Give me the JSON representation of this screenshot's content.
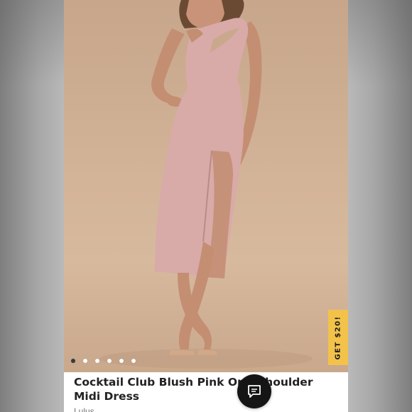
{
  "product": {
    "title": "Cocktail Club Blush Pink One-Shoulder Midi Dress",
    "brand": "Lulus"
  },
  "gallery": {
    "image_count": 6,
    "active_index": 0
  },
  "promo": {
    "label": "GET $20!",
    "color": "#f2c24a"
  },
  "chat": {
    "icon": "chat-bubble-icon",
    "color": "#151515"
  },
  "colors": {
    "dress": "#d8aaa8",
    "backdrop": "#d2b397"
  }
}
